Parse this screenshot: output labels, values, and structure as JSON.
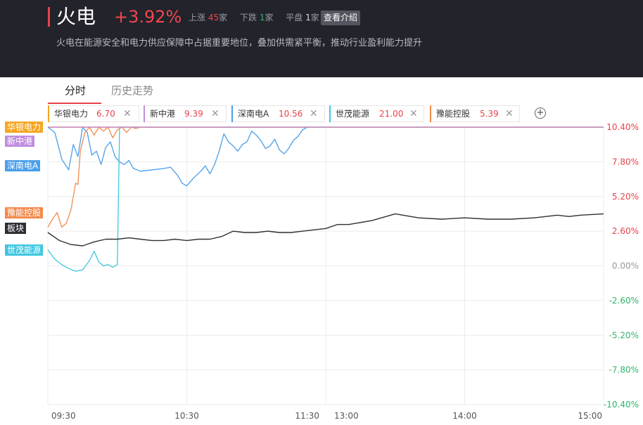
{
  "header": {
    "title": "火电",
    "change_pct": "+3.92%",
    "stats": {
      "up_label": "上涨",
      "up_count": "45",
      "up_unit": "家",
      "down_label": "下跌",
      "down_count": "1",
      "down_unit": "家",
      "flat_label": "平盘",
      "flat_count": "1",
      "flat_unit": "家"
    },
    "intro_button": "查看介绍",
    "description": "火电在能源安全和电力供应保障中占据重要地位，叠加供需紧平衡，推动行业盈利能力提升"
  },
  "tabs": [
    {
      "label": "分时",
      "active": true
    },
    {
      "label": "历史走势",
      "active": false
    }
  ],
  "stocks": [
    {
      "name": "华银电力",
      "price": "6.70",
      "color": "#f5a623"
    },
    {
      "name": "新中港",
      "price": "9.39",
      "color": "#c08ee0"
    },
    {
      "name": "深南电A",
      "price": "10.56",
      "color": "#4a9eea"
    },
    {
      "name": "世茂能源",
      "price": "21.00",
      "color": "#3fc6e0"
    },
    {
      "name": "豫能控股",
      "price": "5.39",
      "color": "#f28a4c"
    }
  ],
  "add_icon": "plus-circle-icon",
  "close_icon": "close-icon",
  "left_tags": [
    {
      "label": "华银电力",
      "color": "#f5a623"
    },
    {
      "label": "新中港",
      "color": "#c08ee0"
    },
    {
      "label": "深南电A",
      "color": "#4a9eea"
    },
    {
      "label": "豫能控股",
      "color": "#f28a4c"
    },
    {
      "label": "板块",
      "color": "#2e2e36"
    },
    {
      "label": "世茂能源",
      "color": "#3fc6e0"
    }
  ],
  "chart_data": {
    "type": "line",
    "x_ticks": [
      "09:30",
      "10:30",
      "11:30",
      "13:00",
      "14:00",
      "15:00"
    ],
    "y_ticks": [
      "10.40%",
      "7.80%",
      "5.20%",
      "2.60%",
      "0.00%",
      "-2.60%",
      "-5.20%",
      "-7.80%",
      "-10.40%"
    ],
    "ylim": [
      -10.4,
      10.4
    ],
    "grid": true,
    "colors": {
      "up": "#e8424a",
      "down": "#2fb56b",
      "flat": "#999999",
      "grid": "#ececec",
      "limit": "#f07a7a"
    },
    "sector": {
      "name": "板块",
      "color": "#2e2e36",
      "x": [
        0,
        5,
        10,
        15,
        20,
        25,
        30,
        35,
        40,
        45,
        50,
        55,
        60,
        65,
        70,
        75,
        80,
        85,
        90,
        95,
        100,
        105,
        110,
        115,
        120,
        125,
        130,
        140,
        150,
        160,
        170,
        180,
        190,
        200,
        210,
        220,
        225,
        230,
        240
      ],
      "y": [
        2.5,
        1.9,
        1.6,
        1.5,
        1.8,
        2.0,
        2.0,
        2.1,
        2.0,
        1.9,
        1.9,
        2.0,
        1.9,
        2.0,
        2.0,
        2.2,
        2.6,
        2.5,
        2.5,
        2.6,
        2.5,
        2.5,
        2.6,
        2.7,
        2.8,
        3.1,
        3.1,
        3.4,
        3.9,
        3.6,
        3.5,
        3.6,
        3.5,
        3.5,
        3.6,
        3.8,
        3.7,
        3.8,
        3.9
      ]
    },
    "series": [
      {
        "name": "深南电A",
        "color": "#4a9eea",
        "x": [
          0,
          3,
          6,
          9,
          11,
          13,
          15,
          17,
          19,
          21,
          23,
          25,
          27,
          29,
          31,
          33,
          35,
          37,
          40,
          45,
          50,
          53,
          56,
          58,
          60,
          63,
          66,
          68,
          70,
          72,
          74,
          76,
          78,
          80,
          82,
          84,
          86,
          88,
          90,
          92,
          94,
          96,
          98,
          100,
          102,
          104,
          106,
          108,
          110,
          112
        ],
        "y": [
          10.4,
          10.0,
          8.0,
          7.2,
          9.1,
          8.2,
          10.4,
          10.0,
          8.3,
          8.6,
          7.6,
          8.9,
          9.3,
          8.2,
          7.8,
          7.6,
          7.9,
          7.3,
          7.1,
          7.2,
          7.3,
          7.4,
          6.8,
          6.2,
          6.0,
          6.6,
          7.1,
          7.5,
          6.9,
          7.6,
          8.6,
          9.9,
          9.3,
          9.0,
          8.6,
          9.1,
          9.3,
          10.1,
          9.8,
          9.4,
          8.8,
          9.0,
          9.5,
          8.7,
          8.4,
          8.8,
          9.4,
          9.7,
          10.2,
          10.4
        ]
      },
      {
        "name": "豫能控股",
        "color": "#f28a4c",
        "x": [
          0,
          2,
          4,
          6,
          8,
          10,
          12,
          13,
          14,
          16,
          18,
          20,
          22,
          24,
          26,
          28,
          30,
          32,
          34,
          36,
          38,
          40,
          240
        ],
        "y": [
          2.9,
          3.5,
          4.0,
          2.9,
          3.2,
          4.2,
          6.2,
          6.1,
          8.6,
          10.0,
          10.4,
          9.8,
          10.4,
          10.1,
          10.4,
          9.6,
          10.2,
          10.4,
          10.0,
          10.4,
          10.3,
          10.4,
          10.4
        ]
      },
      {
        "name": "世茂能源",
        "color": "#3fc6e0",
        "x": [
          0,
          3,
          6,
          9,
          12,
          15,
          18,
          20,
          22,
          24,
          26,
          28,
          30,
          31,
          32,
          240
        ],
        "y": [
          1.2,
          0.5,
          0.1,
          -0.2,
          -0.4,
          -0.3,
          0.4,
          1.1,
          0.3,
          0.0,
          0.1,
          -0.1,
          0.1,
          10.4,
          10.4,
          10.4
        ]
      },
      {
        "name": "华银电力",
        "color": "#f5a623",
        "x": [
          0,
          240
        ],
        "y": [
          10.4,
          10.4
        ]
      },
      {
        "name": "新中港",
        "color": "#c08ee0",
        "x": [
          0,
          240
        ],
        "y": [
          10.4,
          10.4
        ]
      }
    ]
  }
}
